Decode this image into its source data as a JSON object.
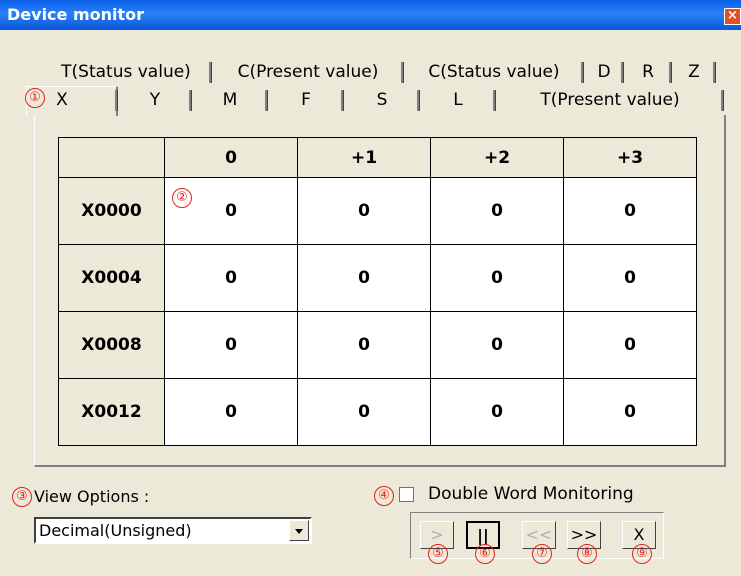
{
  "window": {
    "title": "Device monitor",
    "close_label": "×"
  },
  "tabs_row1": [
    "T(Status value)",
    "C(Present value)",
    "C(Status value)",
    "D",
    "R",
    "Z"
  ],
  "tabs_row2": [
    "X",
    "Y",
    "M",
    "F",
    "S",
    "L",
    "T(Present value)"
  ],
  "active_tab": "X",
  "grid": {
    "corner": "",
    "columns": [
      "0",
      "+1",
      "+2",
      "+3"
    ],
    "rows": [
      {
        "label": "X0000",
        "values": [
          "0",
          "0",
          "0",
          "0"
        ]
      },
      {
        "label": "X0004",
        "values": [
          "0",
          "0",
          "0",
          "0"
        ]
      },
      {
        "label": "X0008",
        "values": [
          "0",
          "0",
          "0",
          "0"
        ]
      },
      {
        "label": "X0012",
        "values": [
          "0",
          "0",
          "0",
          "0"
        ]
      }
    ]
  },
  "view_options": {
    "label": "View Options :",
    "selected": "Decimal(Unsigned)"
  },
  "double_word": {
    "label": "Double Word Monitoring",
    "checked": false
  },
  "buttons": [
    {
      "label": ">",
      "state": "disabled"
    },
    {
      "label": "||",
      "state": "pressed"
    },
    {
      "label": "<<",
      "state": "disabled"
    },
    {
      "label": ">>",
      "state": "enabled"
    },
    {
      "label": "X",
      "state": "enabled"
    }
  ],
  "markers": [
    "①",
    "②",
    "③",
    "④",
    "⑤",
    "⑥",
    "⑦",
    "⑧",
    "⑨"
  ],
  "colors": {
    "title_bar": "#0a5fe8",
    "marker": "#e8201a",
    "dialog_bg": "#ece9d8"
  }
}
